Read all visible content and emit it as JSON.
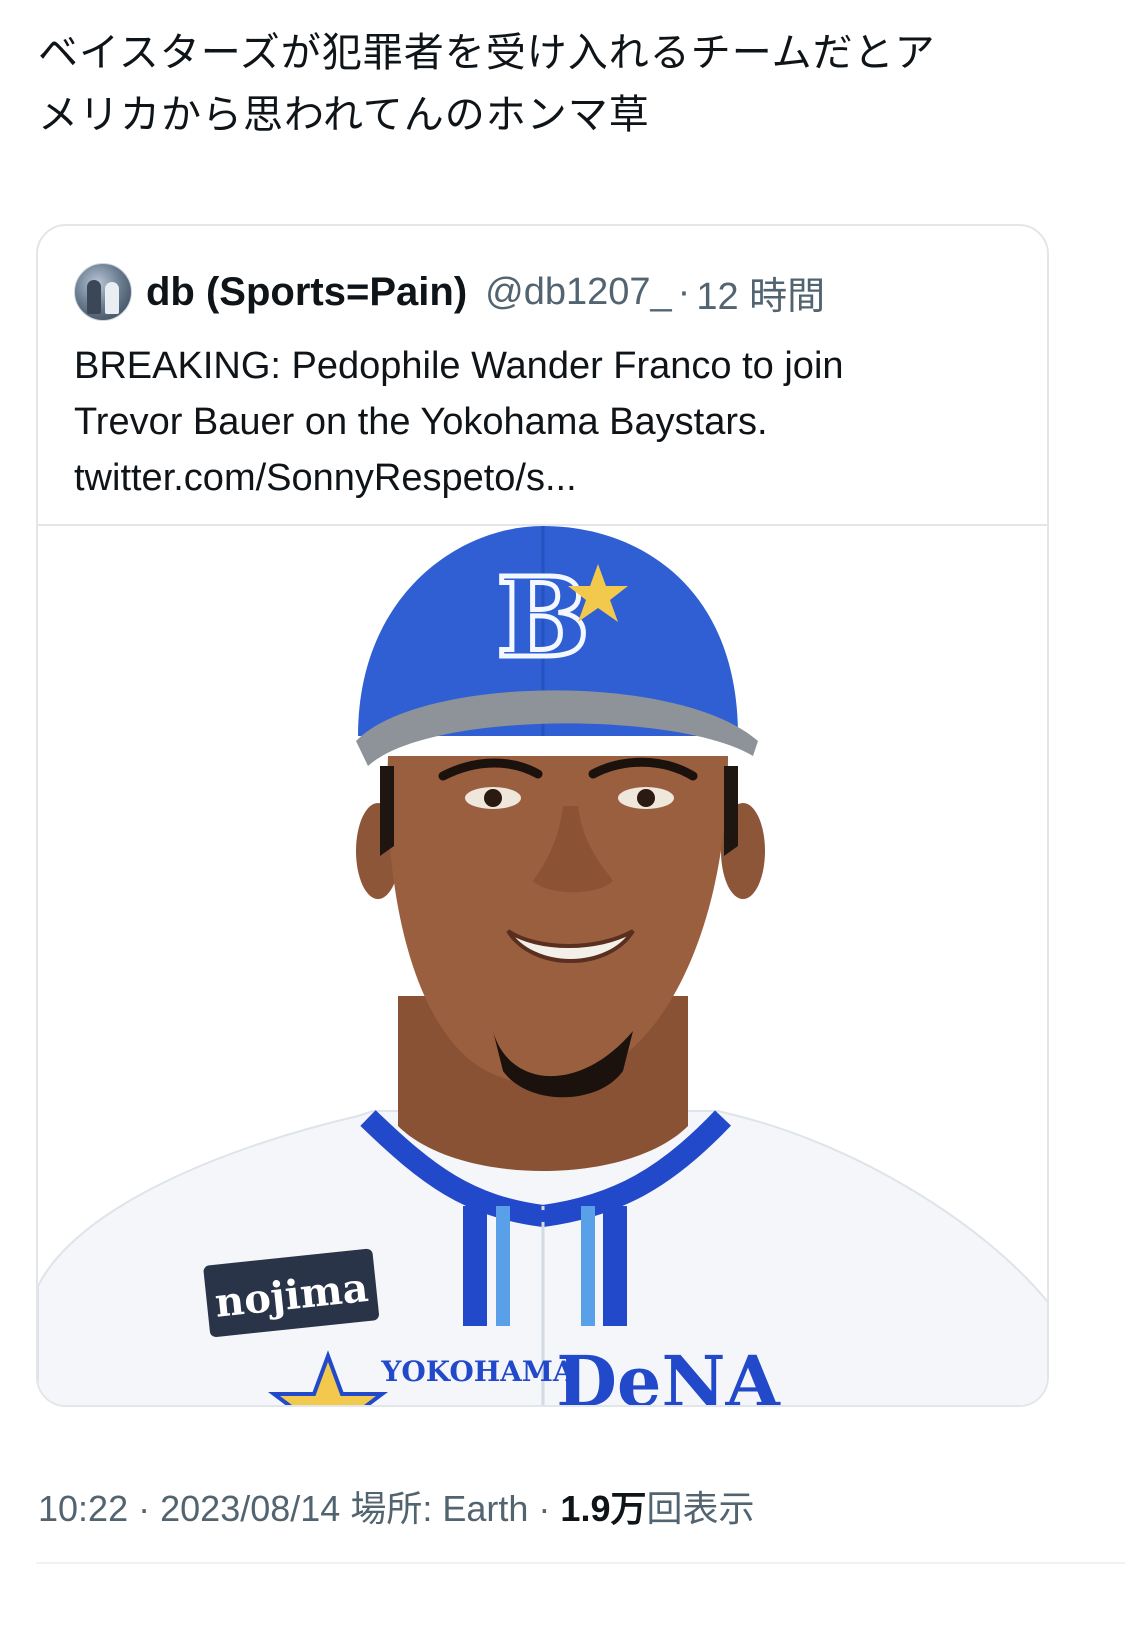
{
  "tweet": {
    "text_line1": "ベイスターズが犯罪者を受け入れるチームだとア",
    "text_line2": "メリカから思われてんのホンマ草"
  },
  "quote": {
    "name": "db (Sports=Pain)",
    "handle": "@db1207_",
    "separator": "·",
    "time": "12 時間",
    "body_line1": "BREAKING: Pedophile Wander Franco to join",
    "body_line2": "Trevor Bauer on the Yokohama Baystars.",
    "body_line3": "twitter.com/SonnyRespeto/s..."
  },
  "photo": {
    "cap_logo": "B",
    "sponsor": "nojima",
    "chest_small": "YOKOHAMA",
    "chest_big": "DeNA",
    "colors": {
      "cap_blue": "#2f5fd3",
      "brim_gray": "#8e9399",
      "jersey": "#f4f6f9",
      "trim_blue": "#2149c9",
      "skin": "#9a5f3e",
      "hair": "#1f1612"
    }
  },
  "meta": {
    "time": "10:22",
    "date": "2023/08/14",
    "location_label": "場所: Earth",
    "views_count": "1.9",
    "views_unit": "万",
    "views_label": "回表示",
    "sep": "·"
  }
}
